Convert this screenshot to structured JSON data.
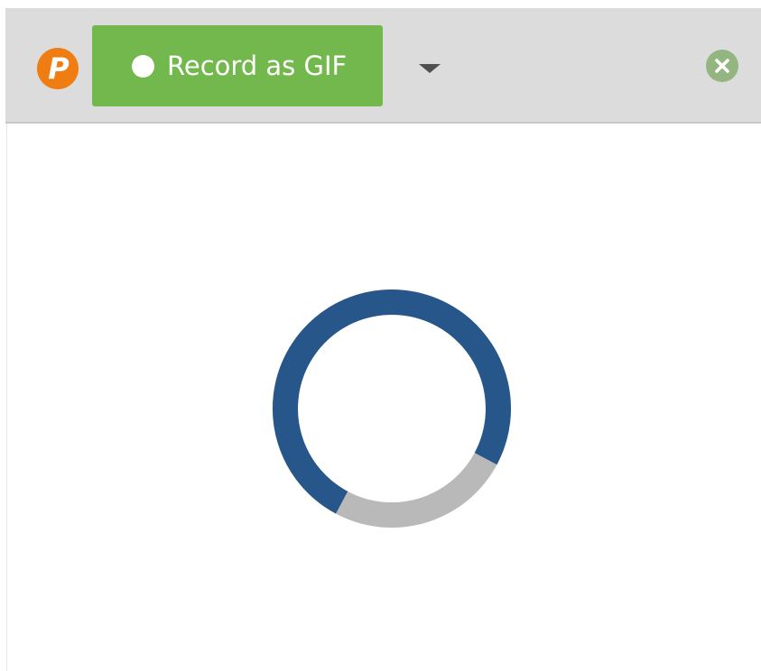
{
  "toolbar": {
    "logo_letter": "P",
    "record_button_label": "Record as GIF",
    "icons": {
      "logo": "app-logo-icon",
      "record": "record-dot-icon",
      "dropdown": "caret-down-icon",
      "close": "close-icon"
    }
  },
  "content": {
    "loading_progress": 0.75,
    "spinner_colors": {
      "progress": "#26568a",
      "track": "#b9b9b9"
    }
  },
  "colors": {
    "toolbar_bg": "#dcdcdc",
    "record_button": "#73b84c",
    "logo": "#f07d12",
    "close_button": "#93b680"
  }
}
